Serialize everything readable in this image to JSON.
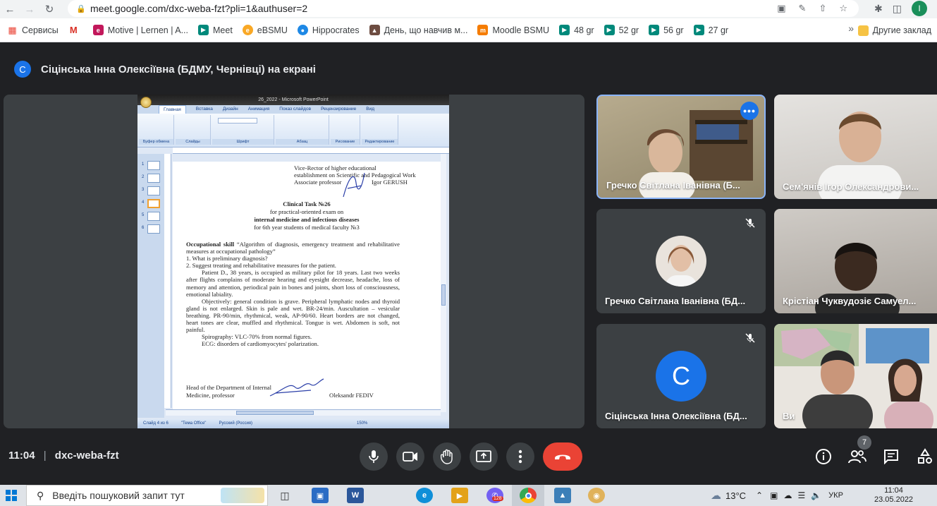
{
  "browser": {
    "url": "meet.google.com/dxc-weba-fzt?pli=1&authuser=2",
    "profile_initial": "I",
    "bookmarks": [
      {
        "label": "Сервисы",
        "color": "#ea4335"
      },
      {
        "label": "",
        "color": "#d93025"
      },
      {
        "label": "Motive | Lernen | A...",
        "color": "#c2185b"
      },
      {
        "label": "Meet",
        "color": "#00897b"
      },
      {
        "label": "eBSMU",
        "color": "#f9a825"
      },
      {
        "label": "Hippocrates",
        "color": "#1e88e5"
      },
      {
        "label": "День, що навчив м...",
        "color": "#6d4c41"
      },
      {
        "label": "Moodle BSMU",
        "color": "#f57c00"
      },
      {
        "label": "48 gr",
        "color": "#00897b"
      },
      {
        "label": "52 gr",
        "color": "#00897b"
      },
      {
        "label": "56 gr",
        "color": "#00897b"
      },
      {
        "label": "27 gr",
        "color": "#00897b"
      }
    ],
    "other_bookmarks": "Другие заклад"
  },
  "meet": {
    "presenter_avatar": "С",
    "presenting_text": "Сіцінська Інна Олексіївна (БДМУ, Чернівці) на екрані",
    "meeting_time": "11:04",
    "meeting_code": "dxc-weba-fzt",
    "participants_count": "7",
    "tiles": [
      {
        "name": "Гречко Світлана Іванівна (Б..."
      },
      {
        "name": "Сем'янів Ігор Олександрови..."
      },
      {
        "name": "Гречко Світлана Іванівна (БД..."
      },
      {
        "name": "Крістіан Чуквудозіє Самуел..."
      },
      {
        "name": "Сіцінська Інна Олексіївна (БД...",
        "avatar": "С"
      },
      {
        "name": "Ви"
      }
    ]
  },
  "ppt": {
    "title": "26_2022 - Microsoft PowerPoint",
    "tabs": [
      "Главная",
      "Вставка",
      "Дизайн",
      "Анимация",
      "Показ слайдов",
      "Рецензирование",
      "Вид"
    ],
    "groups": [
      "Буфер обмена",
      "Слайды",
      "Шрифт",
      "Абзац",
      "Рисование",
      "Редактирование"
    ],
    "status": [
      "Слайд 4 из 6",
      "\"Тема Office\"",
      "Русский (Россия)"
    ],
    "zoom": "150%",
    "doc": {
      "header1": "Vice-Rector of higher educational",
      "header2": "establishment on Scientific and Pedagogical Work",
      "header3": "Associate professor",
      "header3b": "Igor GERUSH",
      "task_title": "Clinical Task №26",
      "sub1": "for practical-oriented exam on",
      "sub2": "internal medicine and infectious diseases",
      "sub3": "for 6th year students of medical faculty №3",
      "skill_bold": "Occupational skill",
      "skill_text": "“Algorithm of diagnosis, emergency treatment and rehabilitative measures at occupational pathology”",
      "q1": "1.      What is preliminary diagnosis?",
      "q2": "2.      Suggest treating and rehabilitative measures for the patient.",
      "para1": "Patient D., 38 years, is occupied as military pilot for 18 years. Last two weeks after flights complains of moderate hearing and eyesight decrease, headache, loss of memory and attention, periodical pain in bones and joints, short loss of consciousness, emotional labiality.",
      "para2": "Objectively: general condition is grave. Peripheral lymphatic nodes and thyroid gland is not enlarged. Skin is pale and wet. BR-24/min. Auscultation – vesicular breathing. PR-90/min, rhythmical, weak, AP-90/60. Heart borders are not changed, heart tones are clear, muffled and rhythmical. Tongue is wet. Abdomen is soft, not painful.",
      "para3": "Spirography: VLC-70% from normal figures.",
      "para4": "ECG: disorders of cardiomyocytes' polarization.",
      "footer1": "Head of the Department of Internal",
      "footer2": "Medicine, professor",
      "footer2b": "Oleksandr FEDIV"
    }
  },
  "taskbar": {
    "search_placeholder": "Введіть пошуковий запит тут",
    "temperature": "13°C",
    "language": "УКР",
    "clock_time": "11:04",
    "clock_date": "23.05.2022",
    "viber_badge": "128"
  }
}
